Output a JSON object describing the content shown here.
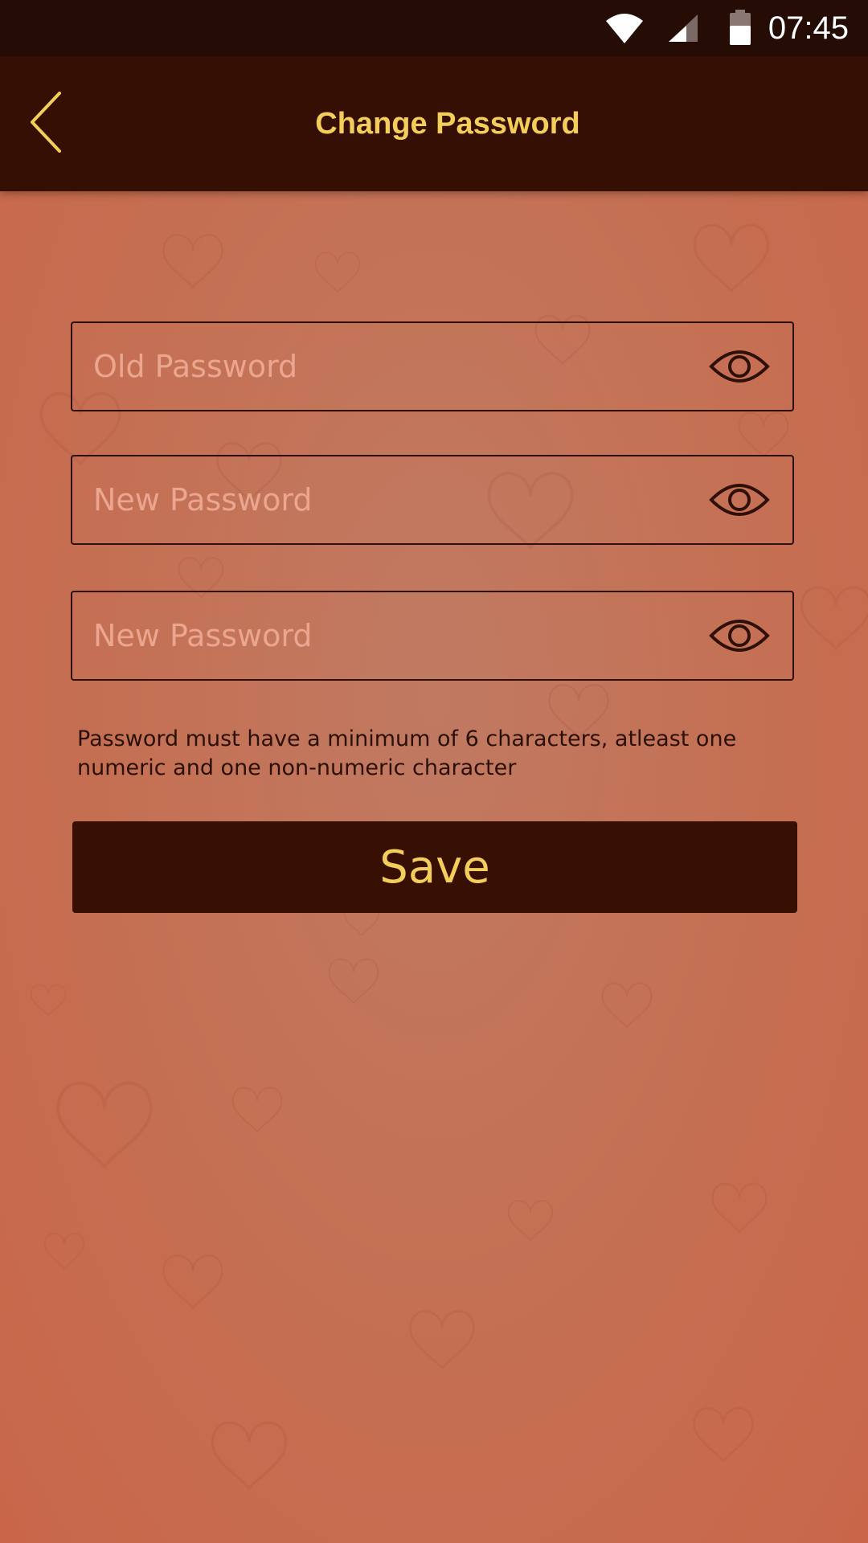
{
  "status_bar": {
    "time": "07:45",
    "icons": [
      "wifi-icon",
      "cell-signal-icon",
      "battery-icon"
    ]
  },
  "app_bar": {
    "title": "Change Password",
    "back_icon": "chevron-left-icon"
  },
  "form": {
    "old_password": {
      "placeholder": "Old Password",
      "value": "",
      "toggle_icon": "eye-icon"
    },
    "new_password": {
      "placeholder": "New Password",
      "value": "",
      "toggle_icon": "eye-icon"
    },
    "confirm_password": {
      "placeholder": "New Password",
      "value": "",
      "toggle_icon": "eye-icon"
    },
    "hint": "Password must have a minimum of 6 characters, atleast one numeric and one non-numeric character",
    "save_label": "Save"
  },
  "colors": {
    "status_bar_bg": "#250d05",
    "app_bar_bg": "#350f04",
    "accent": "#f4ce5a",
    "background": "#c5705a",
    "field_border": "#2e1008",
    "placeholder": "#eaa68f"
  }
}
